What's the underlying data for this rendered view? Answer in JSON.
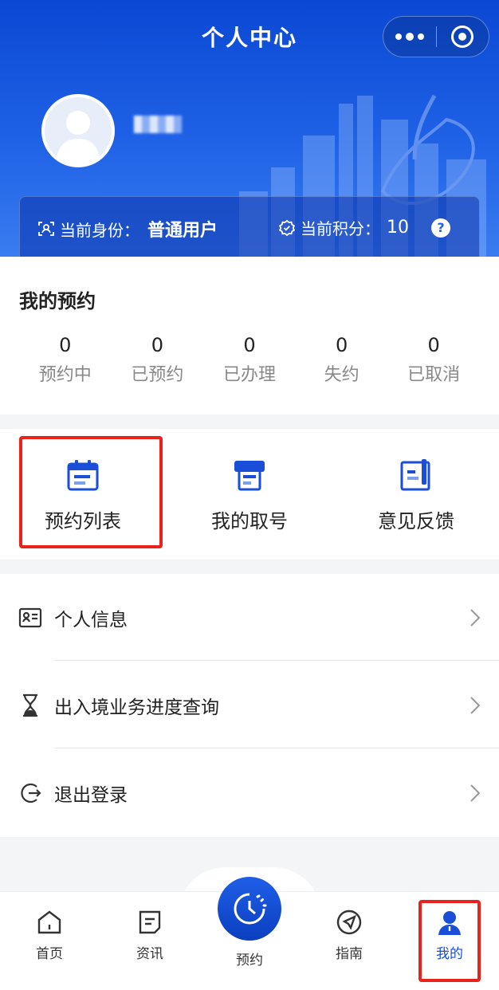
{
  "window": {
    "title": "个人中心"
  },
  "capsule": {
    "more_icon": "more-dots-icon",
    "close_icon": "target-close-icon"
  },
  "profile": {
    "avatar_icon": "user-avatar-icon",
    "identity_label": "当前身份：",
    "identity_value": "普通用户",
    "points_label": "当前积分：",
    "points_value": "10",
    "help_label": "?"
  },
  "appointments": {
    "title": "我的预约",
    "stats": [
      {
        "count": "0",
        "label": "预约中"
      },
      {
        "count": "0",
        "label": "已预约"
      },
      {
        "count": "0",
        "label": "已办理"
      },
      {
        "count": "0",
        "label": "失约"
      },
      {
        "count": "0",
        "label": "已取消"
      }
    ]
  },
  "quick_actions": [
    {
      "label": "预约列表",
      "icon": "calendar-list-icon"
    },
    {
      "label": "我的取号",
      "icon": "ticket-machine-icon"
    },
    {
      "label": "意见反馈",
      "icon": "feedback-document-icon"
    }
  ],
  "menu": [
    {
      "label": "个人信息",
      "icon": "id-card-icon"
    },
    {
      "label": "出入境业务进度查询",
      "icon": "hourglass-icon"
    },
    {
      "label": "退出登录",
      "icon": "logout-icon"
    }
  ],
  "tabbar": [
    {
      "label": "首页",
      "icon": "home-icon"
    },
    {
      "label": "资讯",
      "icon": "news-icon"
    },
    {
      "label": "预约",
      "icon": "clock-appointment-icon"
    },
    {
      "label": "指南",
      "icon": "navigation-guide-icon"
    },
    {
      "label": "我的",
      "icon": "person-icon"
    }
  ],
  "colors": {
    "primary": "#1a4ed8",
    "highlight": "#e8231c",
    "header_top": "#0b48d4"
  }
}
